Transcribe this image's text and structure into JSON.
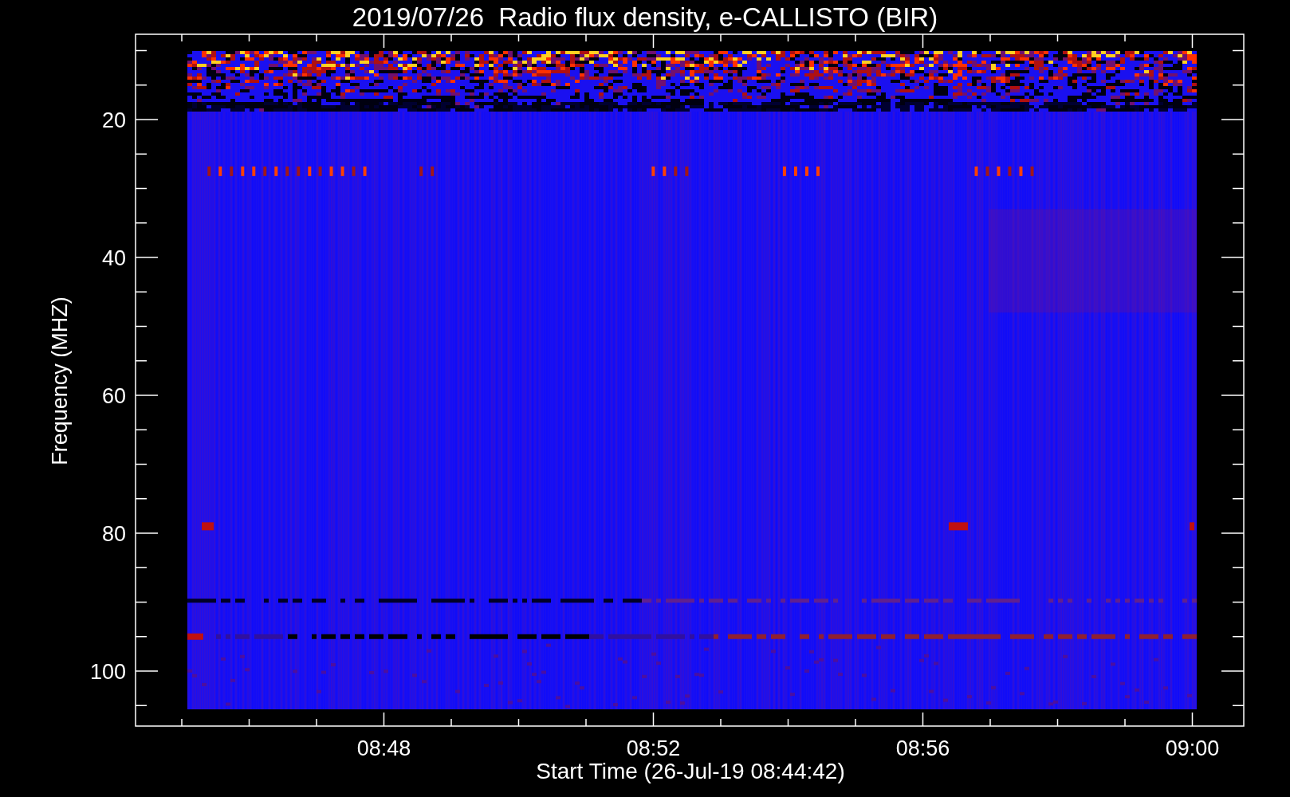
{
  "title": "2019/07/26  Radio flux density, e-CALLISTO (BIR)",
  "y_axis": {
    "label": "Frequency (MHZ)",
    "ticks": [
      "20",
      "40",
      "60",
      "80",
      "100"
    ]
  },
  "x_axis": {
    "label": "Start Time (26-Jul-19 08:44:42)",
    "ticks": [
      "08:48",
      "08:52",
      "08:56",
      "09:00"
    ]
  }
}
